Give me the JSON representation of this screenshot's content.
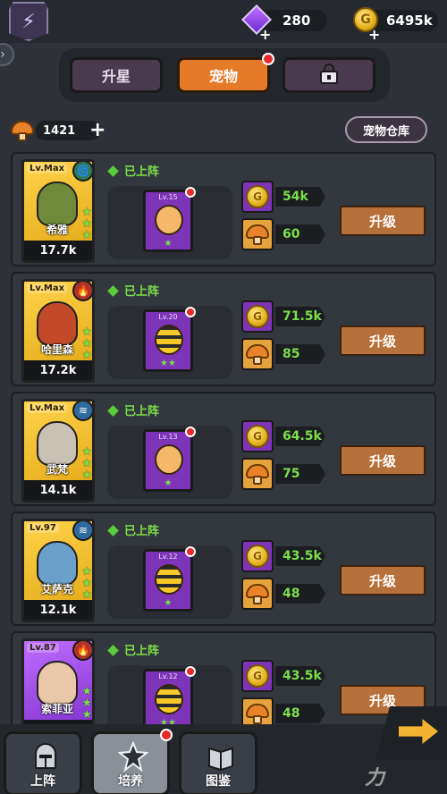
{
  "topbar": {
    "gems": "280",
    "gold": "6495k",
    "gold_icon_letter": "G",
    "crest_icon": "rune-crest-icon"
  },
  "tabs": [
    {
      "label": "升星",
      "active": false
    },
    {
      "label": "宠物",
      "active": true,
      "badge": true
    },
    {
      "label": "",
      "icon": "locked-chest-icon",
      "active": false
    }
  ],
  "mushroom_count": "1421",
  "storage_label": "宠物仓库",
  "status_label": "已上阵",
  "upgrade_label": "升级",
  "coin_letter": "G",
  "heroes": [
    {
      "lv": "Lv.Max",
      "name": "希雅",
      "power": "17.7k",
      "element": "wind",
      "frame": "gold",
      "pet_lv": "Lv.15",
      "pet": "dog",
      "pet_stars": "★",
      "gold_cost": "54k",
      "mush_cost": "60"
    },
    {
      "lv": "Lv.Max",
      "name": "哈里森",
      "power": "17.2k",
      "element": "fire",
      "frame": "gold",
      "pet_lv": "Lv.20",
      "pet": "bee",
      "pet_stars": "★★",
      "gold_cost": "71.5k",
      "mush_cost": "85"
    },
    {
      "lv": "Lv.Max",
      "name": "武梵",
      "power": "14.1k",
      "element": "water",
      "frame": "gold",
      "pet_lv": "Lv.13",
      "pet": "dog",
      "pet_stars": "★",
      "gold_cost": "64.5k",
      "mush_cost": "75"
    },
    {
      "lv": "Lv.97",
      "name": "艾萨克",
      "power": "12.1k",
      "element": "water",
      "frame": "gold",
      "pet_lv": "Lv.12",
      "pet": "bee",
      "pet_stars": "★",
      "gold_cost": "43.5k",
      "mush_cost": "48"
    },
    {
      "lv": "Lv.87",
      "name": "索菲亚",
      "power": "11.7k",
      "element": "fire",
      "frame": "purple",
      "pet_lv": "Lv.12",
      "pet": "bee",
      "pet_stars": "★★",
      "gold_cost": "43.5k",
      "mush_cost": "48"
    }
  ],
  "bottom_nav": [
    {
      "label": "上阵",
      "icon": "knight-helmet-icon",
      "active": false
    },
    {
      "label": "培养",
      "icon": "star-burst-icon",
      "active": true,
      "badge": true
    },
    {
      "label": "图鉴",
      "icon": "book-icon",
      "active": false
    }
  ],
  "watermark": "力"
}
